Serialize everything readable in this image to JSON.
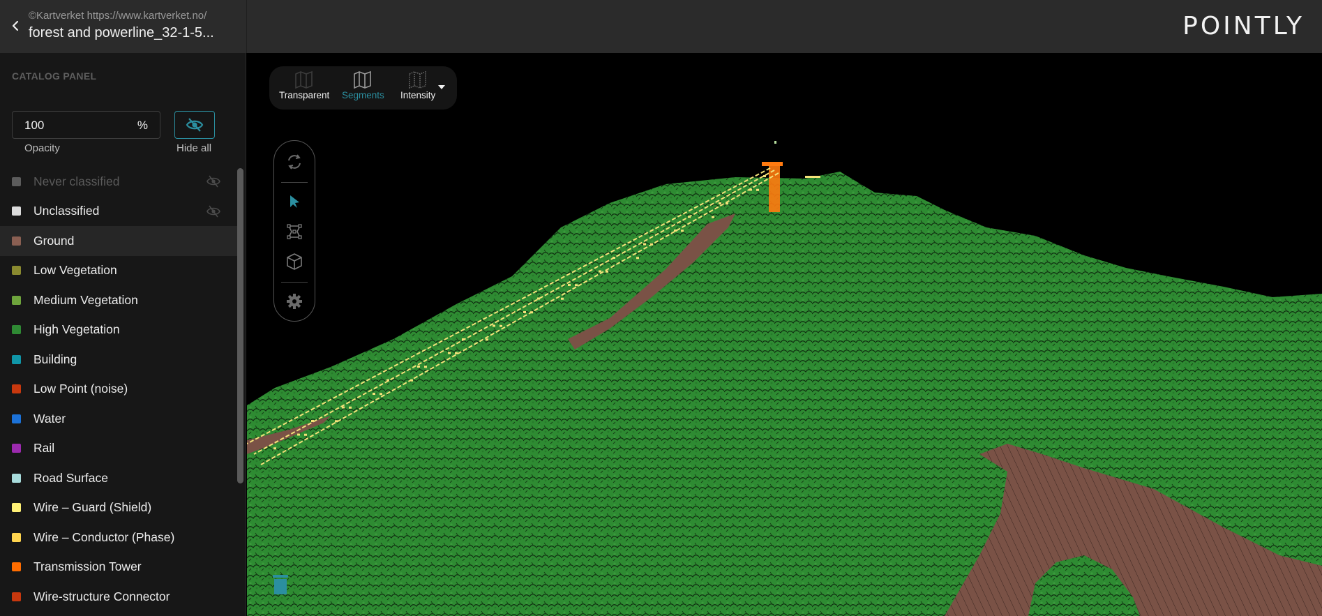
{
  "header": {
    "back_icon": "chevron-left-icon",
    "credit": "©Kartverket https://www.kartverket.no/",
    "title": "forest and powerline_32-1-5...",
    "logo": "POINTLY"
  },
  "sidebar": {
    "panel_title": "CATALOG PANEL",
    "opacity": {
      "value": "100",
      "unit": "%",
      "label": "Opacity"
    },
    "hide_all": {
      "label": "Hide all",
      "icon": "eye-off-icon",
      "color": "#2b8fa0"
    },
    "classes": [
      {
        "label": "Never classified",
        "color": "#5c5c5c",
        "disabled": true,
        "eye": "eye-off-icon"
      },
      {
        "label": "Unclassified",
        "color": "#dcdcdc",
        "disabled": false,
        "eye": "eye-off-icon"
      },
      {
        "label": "Ground",
        "color": "#8a5f52",
        "hover": true
      },
      {
        "label": "Low Vegetation",
        "color": "#8a8a30"
      },
      {
        "label": "Medium Vegetation",
        "color": "#6ea43c"
      },
      {
        "label": "High Vegetation",
        "color": "#2f8a34"
      },
      {
        "label": "Building",
        "color": "#1096a8"
      },
      {
        "label": "Low Point (noise)",
        "color": "#c8380e"
      },
      {
        "label": "Water",
        "color": "#1c72d8"
      },
      {
        "label": "Rail",
        "color": "#9c2aae"
      },
      {
        "label": "Road Surface",
        "color": "#a8dcdc"
      },
      {
        "label": "Wire – Guard (Shield)",
        "color": "#fff176"
      },
      {
        "label": "Wire – Conductor (Phase)",
        "color": "#ffd54f"
      },
      {
        "label": "Transmission Tower",
        "color": "#ff6d00"
      },
      {
        "label": "Wire-structure Connector",
        "color": "#c8380e"
      }
    ]
  },
  "viewport": {
    "modes": [
      {
        "label": "Transparent",
        "icon": "map-transparent-icon",
        "active": false
      },
      {
        "label": "Segments",
        "icon": "map-segments-icon",
        "active": true
      },
      {
        "label": "Intensity",
        "icon": "map-intensity-icon",
        "active": false
      }
    ],
    "mode_dropdown_icon": "caret-down-icon",
    "tools": [
      {
        "name": "rotate",
        "icon": "rotate-icon"
      },
      {
        "name": "select",
        "icon": "cursor-icon",
        "active": true
      },
      {
        "name": "polygon-select",
        "icon": "polygon-select-icon"
      },
      {
        "name": "box-select",
        "icon": "cube-icon"
      },
      {
        "name": "settings",
        "icon": "gear-icon"
      }
    ],
    "trash_icon": "trash-icon",
    "accent": "#2b8fa0",
    "scene_colors": {
      "vegetation": "#2e8b32",
      "ground": "#7a5246",
      "wire": "#f4e27a",
      "tower": "#ff7a10"
    }
  }
}
